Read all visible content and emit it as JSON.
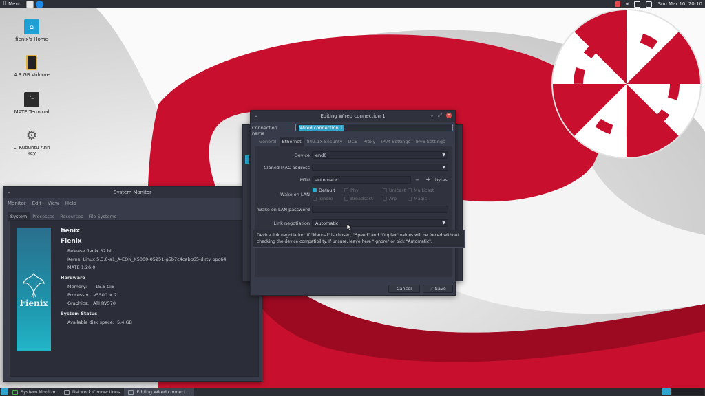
{
  "topbar": {
    "menu_label": "Menu",
    "clock": "Sun Mar 10, 20:10"
  },
  "desktop_icons": [
    {
      "label": "fienix's Home",
      "icon": "home-folder-icon"
    },
    {
      "label": "4.3 GB Volume",
      "icon": "sd-card-icon"
    },
    {
      "label": "MATE Terminal",
      "icon": "terminal-icon"
    },
    {
      "label": "Li Kubuntu Ann key",
      "icon": "settings-gear-icon"
    }
  ],
  "system_monitor": {
    "title": "System Monitor",
    "menu": [
      "Monitor",
      "Edit",
      "View",
      "Help"
    ],
    "tabs": [
      "System",
      "Processes",
      "Resources",
      "File Systems"
    ],
    "active_tab": "System",
    "logo_text": "Fienix",
    "hostname": "fienix",
    "os_name": "Fienix",
    "release": "Release fienix 32 bit",
    "kernel": "Kernel Linux 5.3.0-a1_A-EON_X5000-05251-g5b7c4cabb65-dirty ppc64",
    "mate": "MATE 1.26.0",
    "hardware_label": "Hardware",
    "memory_label": "Memory:",
    "memory_value": "15.6 GiB",
    "processor_label": "Processor:",
    "processor_value": "e5500 × 2",
    "graphics_label": "Graphics:",
    "graphics_value": "ATI RV570",
    "status_label": "System Status",
    "disk_label": "Available disk space:",
    "disk_value": "5.4 GB"
  },
  "editor": {
    "title": "Editing Wired connection 1",
    "connection_name_label": "Connection name",
    "connection_name_value": "Wired connection 1",
    "tabs": [
      "General",
      "Ethernet",
      "802.1X Security",
      "DCB",
      "Proxy",
      "IPv4 Settings",
      "IPv6 Settings"
    ],
    "active_tab": "Ethernet",
    "device_label": "Device",
    "device_value": "end0",
    "cloned_mac_label": "Cloned MAC address",
    "mtu_label": "MTU",
    "mtu_value": "automatic",
    "mtu_minus": "−",
    "mtu_plus": "+",
    "mtu_unit": "bytes",
    "wol_label": "Wake on LAN",
    "wol_options": [
      {
        "label": "Default",
        "checked": true
      },
      {
        "label": "Phy",
        "checked": false
      },
      {
        "label": "Unicast",
        "checked": false
      },
      {
        "label": "Multicast",
        "checked": false
      },
      {
        "label": "Ignore",
        "checked": false
      },
      {
        "label": "Broadcast",
        "checked": false
      },
      {
        "label": "Arp",
        "checked": false
      },
      {
        "label": "Magic",
        "checked": false
      }
    ],
    "wol_password_label": "Wake on LAN password",
    "link_neg_label": "Link negotiation",
    "link_neg_value": "Automatic",
    "tooltip": "Device link negotiation. If \"Manual\" is chosen, \"Speed\" and \"Duplex\" values will be forced without checking the device compatibility. If unsure, leave here \"Ignore\" or pick \"Automatic\".",
    "cancel_label": "Cancel",
    "save_label": "Save"
  },
  "taskbar": {
    "tasks": [
      "System Monitor",
      "Network Connections",
      "Editing Wired connect..."
    ]
  },
  "colors": {
    "accent": "#2fa4cf",
    "desktop_red": "#c8102e",
    "window_bg": "#383c4a",
    "close_red": "#e04a4a"
  }
}
